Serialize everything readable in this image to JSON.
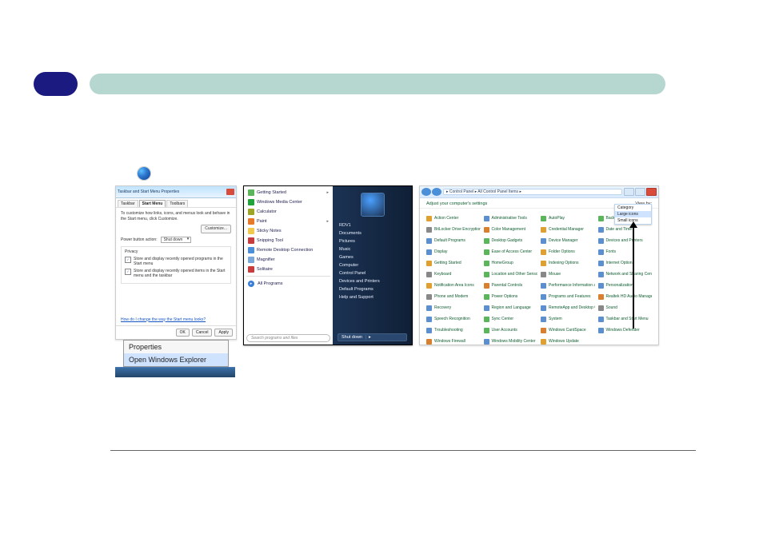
{
  "doc": {
    "badge_text": "",
    "banner_text": ""
  },
  "screenshot1": {
    "window_title": "Taskbar and Start Menu Properties",
    "tabs": {
      "taskbar": "Taskbar",
      "start_menu": "Start Menu",
      "toolbars": "Toolbars"
    },
    "desc": "To customize how links, icons, and menus look and behave in the Start menu, click Customize.",
    "customize_btn": "Customize...",
    "power_label": "Power button action:",
    "power_value": "Shut down",
    "privacy": {
      "header": "Privacy",
      "opt1": "Store and display recently opened programs in the Start menu",
      "opt2": "Store and display recently opened items in the Start menu and the taskbar"
    },
    "link": "How do I change the way the Start menu looks?",
    "buttons": {
      "ok": "OK",
      "cancel": "Cancel",
      "apply": "Apply"
    },
    "context": {
      "properties": "Properties",
      "open_explorer": "Open Windows Explorer"
    }
  },
  "startmenu": {
    "left_items": [
      {
        "label": "Getting Started",
        "color": "#5bb55b",
        "arrow": true
      },
      {
        "label": "Windows Media Center",
        "color": "#1fa33a"
      },
      {
        "label": "Calculator",
        "color": "#9da528"
      },
      {
        "label": "Paint",
        "color": "#e77a2a",
        "arrow": true
      },
      {
        "label": "Sticky Notes",
        "color": "#f0c94e"
      },
      {
        "label": "Snipping Tool",
        "color": "#c73d3d"
      },
      {
        "label": "Remote Desktop Connection",
        "color": "#4a8fd8"
      },
      {
        "label": "Magnifier",
        "color": "#7aa7d8"
      },
      {
        "label": "Solitaire",
        "color": "#c73d3d"
      }
    ],
    "all_programs": "All Programs",
    "search_placeholder": "Search programs and files",
    "right_items": [
      "RDV1",
      "Documents",
      "Pictures",
      "Music",
      "Games",
      "Computer",
      "Control Panel",
      "Devices and Printers",
      "Default Programs",
      "Help and Support"
    ],
    "shutdown": "Shut down"
  },
  "controlpanel": {
    "address": "▸ Control Panel ▸ All Control Panel Items ▸",
    "adjust": "Adjust your computer's settings",
    "view_label": "View by:",
    "view_menu": {
      "category": "Category",
      "large": "Large icons",
      "small": "Small icons"
    },
    "items": [
      {
        "l": "Action Center",
        "c": "#e0a030"
      },
      {
        "l": "Administrative Tools",
        "c": "#5b8fd0"
      },
      {
        "l": "AutoPlay",
        "c": "#5bb55b"
      },
      {
        "l": "Backup and Restore",
        "c": "#5bb55b"
      },
      {
        "l": "BitLocker Drive Encryption",
        "c": "#888"
      },
      {
        "l": "Color Management",
        "c": "#d88030"
      },
      {
        "l": "Credential Manager",
        "c": "#e0a030"
      },
      {
        "l": "Date and Time",
        "c": "#5b8fd0"
      },
      {
        "l": "Default Programs",
        "c": "#5b8fd0"
      },
      {
        "l": "Desktop Gadgets",
        "c": "#5bb55b"
      },
      {
        "l": "Device Manager",
        "c": "#5b8fd0"
      },
      {
        "l": "Devices and Printers",
        "c": "#5b8fd0"
      },
      {
        "l": "Display",
        "c": "#5b8fd0"
      },
      {
        "l": "Ease of Access Center",
        "c": "#5bb55b"
      },
      {
        "l": "Folder Options",
        "c": "#e0a030"
      },
      {
        "l": "Fonts",
        "c": "#5b8fd0"
      },
      {
        "l": "Getting Started",
        "c": "#e0a030"
      },
      {
        "l": "HomeGroup",
        "c": "#5bb55b"
      },
      {
        "l": "Indexing Options",
        "c": "#e0a030"
      },
      {
        "l": "Internet Options",
        "c": "#5b8fd0"
      },
      {
        "l": "Keyboard",
        "c": "#888"
      },
      {
        "l": "Location and Other Sensors",
        "c": "#5bb55b"
      },
      {
        "l": "Mouse",
        "c": "#888"
      },
      {
        "l": "Network and Sharing Center",
        "c": "#5b8fd0"
      },
      {
        "l": "Notification Area Icons",
        "c": "#e0a030"
      },
      {
        "l": "Parental Controls",
        "c": "#d88030"
      },
      {
        "l": "Performance Information and Tools",
        "c": "#5b8fd0"
      },
      {
        "l": "Personalization",
        "c": "#5b8fd0"
      },
      {
        "l": "Phone and Modem",
        "c": "#888"
      },
      {
        "l": "Power Options",
        "c": "#5bb55b"
      },
      {
        "l": "Programs and Features",
        "c": "#5b8fd0"
      },
      {
        "l": "Realtek HD Audio Manager",
        "c": "#d88030"
      },
      {
        "l": "Recovery",
        "c": "#5b8fd0"
      },
      {
        "l": "Region and Language",
        "c": "#5b8fd0"
      },
      {
        "l": "RemoteApp and Desktop Connections",
        "c": "#5b8fd0"
      },
      {
        "l": "Sound",
        "c": "#888"
      },
      {
        "l": "Speech Recognition",
        "c": "#5b8fd0"
      },
      {
        "l": "Sync Center",
        "c": "#5bb55b"
      },
      {
        "l": "System",
        "c": "#5b8fd0"
      },
      {
        "l": "Taskbar and Start Menu",
        "c": "#5b8fd0"
      },
      {
        "l": "Troubleshooting",
        "c": "#5b8fd0"
      },
      {
        "l": "User Accounts",
        "c": "#5bb55b"
      },
      {
        "l": "Windows CardSpace",
        "c": "#d88030"
      },
      {
        "l": "Windows Defender",
        "c": "#5b8fd0"
      },
      {
        "l": "Windows Firewall",
        "c": "#d88030"
      },
      {
        "l": "Windows Mobility Center",
        "c": "#5b8fd0"
      },
      {
        "l": "Windows Update",
        "c": "#e0a030"
      }
    ]
  }
}
